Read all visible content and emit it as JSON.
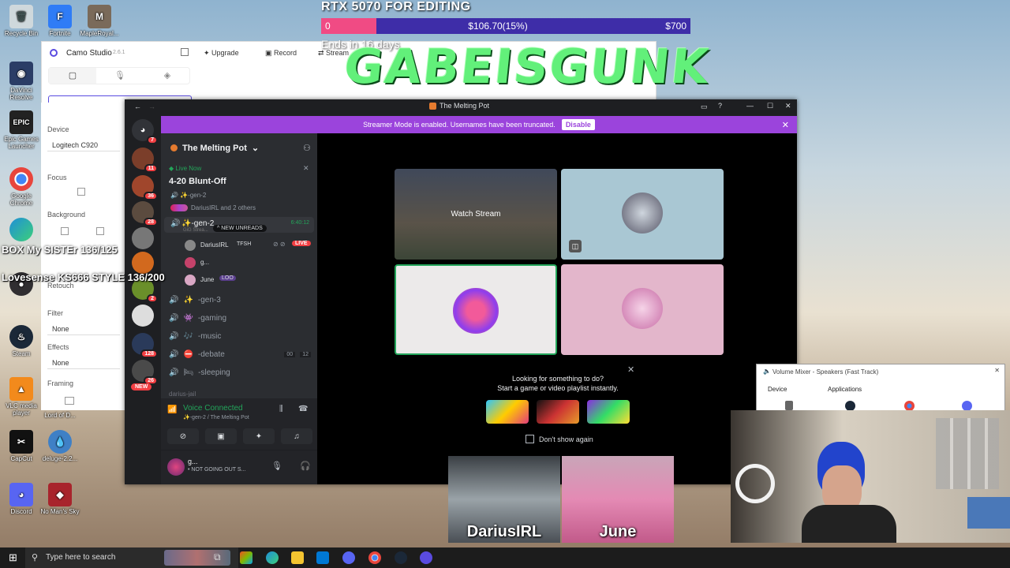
{
  "stream_overlay": {
    "goal_title": "RTX 5070 FOR EDITING",
    "goal_start": "0",
    "goal_current": "$106.70(15%)",
    "goal_target": "$700",
    "goal_progress_percent": 15,
    "goal_ends": "Ends in 16 days",
    "logo_text": "GABEISGUNK",
    "ticker_1": "BOX My SISTEr 136/125",
    "ticker_2": "Lovesense KS666 STYLE 136/200"
  },
  "desktop_icons": [
    {
      "label": "Recycle Bin",
      "icon": "recycle-bin-icon",
      "color": "#cfd8dc"
    },
    {
      "label": "Fortnite",
      "icon": "fortnite-icon",
      "color": "#2f7cf6"
    },
    {
      "label": "MapleRoyal...",
      "icon": "mapleroyals-icon",
      "color": "#7a6a5a"
    },
    {
      "label": "DaVinci Resolve",
      "icon": "davinci-icon",
      "color": "#2b3d66"
    },
    {
      "label": "Epic Games Launcher",
      "icon": "epic-games-icon",
      "color": "#222"
    },
    {
      "label": "Google Chrome",
      "icon": "chrome-icon",
      "color": "#e8453c"
    },
    {
      "label": "Microsoft Edge",
      "icon": "edge-icon",
      "color": "#1f8fd8"
    },
    {
      "label": "OBS Studio",
      "icon": "obs-icon",
      "color": "#302e31"
    },
    {
      "label": "Steam",
      "icon": "steam-icon",
      "color": "#1b2838"
    },
    {
      "label": "VLC media player",
      "icon": "vlc-icon",
      "color": "#f28a1c"
    },
    {
      "label": "Lord of D...",
      "icon": "lotd-icon",
      "color": "#6b4f3a"
    },
    {
      "label": "CapCut",
      "icon": "capcut-icon",
      "color": "#111"
    },
    {
      "label": "deluge-2.2...",
      "icon": "deluge-icon",
      "color": "#3f80c6"
    },
    {
      "label": "Discord",
      "icon": "discord-icon",
      "color": "#5865f2"
    },
    {
      "label": "No Man's Sky",
      "icon": "nms-icon",
      "color": "#a8242c"
    }
  ],
  "camo": {
    "title": "Camo Studio",
    "version": "2.6.1",
    "upgrade": "Upgrade",
    "record": "Record",
    "stream": "Stream",
    "device_label": "Device",
    "device_value": "Logitech C920",
    "focus_label": "Focus",
    "background_label": "Background",
    "retouch_label": "Retouch",
    "filter_label": "Filter",
    "filter_value": "None",
    "effects_label": "Effects",
    "effects_value": "None",
    "framing_label": "Framing"
  },
  "discord": {
    "window_title": "The Melting Pot",
    "banner_text": "Streamer Mode is enabled. Usernames have been truncated.",
    "banner_button": "Disable",
    "server_name": "The Melting Pot",
    "live_now": "Live Now",
    "event_title": "4-20 Blunt-Off",
    "event_channel": "✨-gen-2",
    "event_members": "DariusIRL and 2 others",
    "active_channel": "✨-gen-2",
    "active_time": "6:40:12",
    "new_unreads": "NEW UNREADS",
    "channel_sub": "GiG Strea...",
    "members": [
      {
        "name": "DariusIRL",
        "tag": "TFSH",
        "live": "LIVE"
      },
      {
        "name": "g...",
        "tag": "",
        "live": ""
      },
      {
        "name": "June",
        "tag": "LOO",
        "live": ""
      }
    ],
    "channels": [
      {
        "name": "-gen-3",
        "emoji": "✨"
      },
      {
        "name": "-gaming",
        "emoji": "👾"
      },
      {
        "name": "-music",
        "emoji": "🎶"
      },
      {
        "name": "-debate",
        "emoji": "⛔"
      },
      {
        "name": "-sleeping",
        "emoji": "🛏"
      }
    ],
    "debate_count_a": "00",
    "debate_count_b": "12",
    "cut_channel": "darius-jail",
    "voice_status": "Voice Connected",
    "voice_sub": "✨-gen-2 / The Melting Pot",
    "user_name": "g...",
    "user_status": "• NOT GOING OUT S...",
    "watch_stream": "Watch Stream",
    "suggest_title": "Looking for something to do?",
    "suggest_sub": "Start a game or video playlist instantly.",
    "dont_show": "Don't show again",
    "server_badges": [
      "7",
      "11",
      "36",
      "28",
      "2",
      "128",
      "26"
    ],
    "new_label": "NEW"
  },
  "mixer": {
    "title": "Volume Mixer - Speakers (Fast Track)",
    "device": "Device",
    "applications": "Applications"
  },
  "portraits": [
    {
      "name": "DariusIRL"
    },
    {
      "name": "June"
    }
  ],
  "taskbar": {
    "search_placeholder": "Type here to search"
  }
}
